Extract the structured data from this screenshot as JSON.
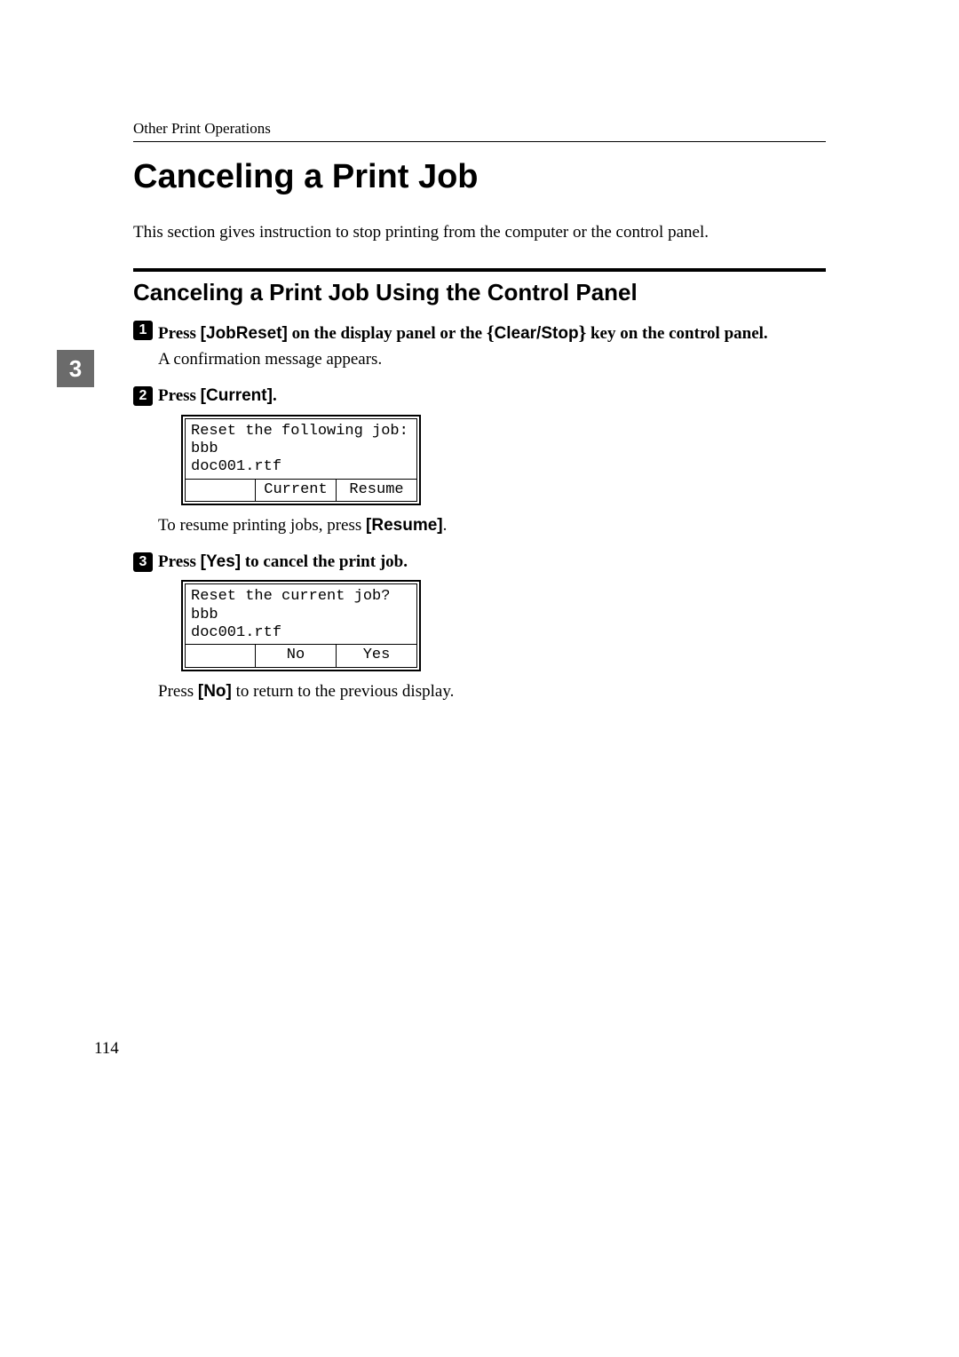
{
  "header": {
    "section": "Other Print Operations"
  },
  "title": "Canceling a Print Job",
  "intro": "This section gives instruction to stop printing from the computer or the control panel.",
  "subheading": "Canceling a Print Job Using the Control Panel",
  "chapter_tab": "3",
  "steps": {
    "s1": {
      "num": "1",
      "bold_pre": "Press ",
      "jobreset": "[JobReset]",
      "bold_mid": " on the display panel or the ",
      "bracket_open": "{",
      "clearstop": "Clear/Stop",
      "bracket_close": "}",
      "bold_post": " key on the control panel.",
      "after": "A confirmation message appears."
    },
    "s2": {
      "num": "2",
      "bold_pre": "Press ",
      "current": "[Current]",
      "bold_post": ".",
      "panel": {
        "line1": "Reset the following job:",
        "line2": "bbb",
        "line3": "doc001.rtf",
        "btn1": "Current",
        "btn2": "Resume"
      },
      "after_pre": "To resume printing jobs, press ",
      "resume": "[Resume]",
      "after_post": "."
    },
    "s3": {
      "num": "3",
      "bold_pre": "Press ",
      "yes": "[Yes]",
      "bold_post": " to cancel the print job.",
      "panel": {
        "line1": "Reset the current job?",
        "line2": "bbb",
        "line3": "doc001.rtf",
        "btn1": "No",
        "btn2": "Yes"
      },
      "after_pre": "Press ",
      "no": "[No]",
      "after_post": " to return to the previous display."
    }
  },
  "page_number": "114"
}
